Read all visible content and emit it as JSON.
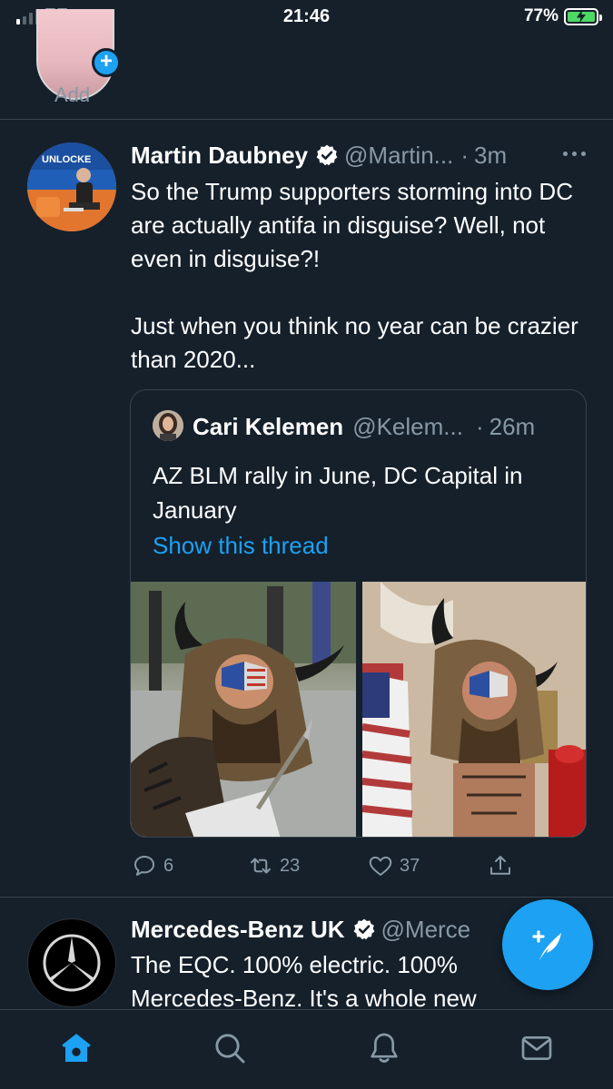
{
  "status_bar": {
    "carrier": "EE",
    "time": "21:46",
    "battery_percent": "77%",
    "signal_bars_active": 1,
    "battery_level": 0.77
  },
  "fleets": {
    "add_label": "Add"
  },
  "tweet": {
    "author_name": "Martin Daubney",
    "handle": "@Martin...",
    "dot": "·",
    "time": "3m",
    "text": "So the Trump supporters storming into DC are actually antifa in disguise? Well, not even in disguise?!\n\nJust when you think no year can be crazier than 2020...",
    "avatar_text": "UNLOCKE",
    "quote": {
      "author_name": "Cari Kelemen",
      "handle": "@Kelem...",
      "dot": "·",
      "time": "26m",
      "text": "AZ BLM rally in June, DC Capital in January",
      "thread_link": "Show this thread"
    },
    "actions": {
      "replies": "6",
      "retweets": "23",
      "likes": "37"
    }
  },
  "tweet2": {
    "author_name": "Mercedes-Benz UK",
    "handle": "@Merce",
    "text": "The EQC. 100% electric. 100% Mercedes-Benz. It's a whole new"
  },
  "colors": {
    "background": "#15202b",
    "accent": "#1da1f2",
    "secondary_text": "#8899a6",
    "divider": "#38444d"
  },
  "icons": [
    "wifi-icon",
    "battery-icon",
    "plus-icon",
    "verified-icon",
    "more-icon",
    "reply-icon",
    "retweet-icon",
    "like-icon",
    "share-icon",
    "compose-icon",
    "home-icon",
    "search-icon",
    "notifications-icon",
    "messages-icon"
  ]
}
